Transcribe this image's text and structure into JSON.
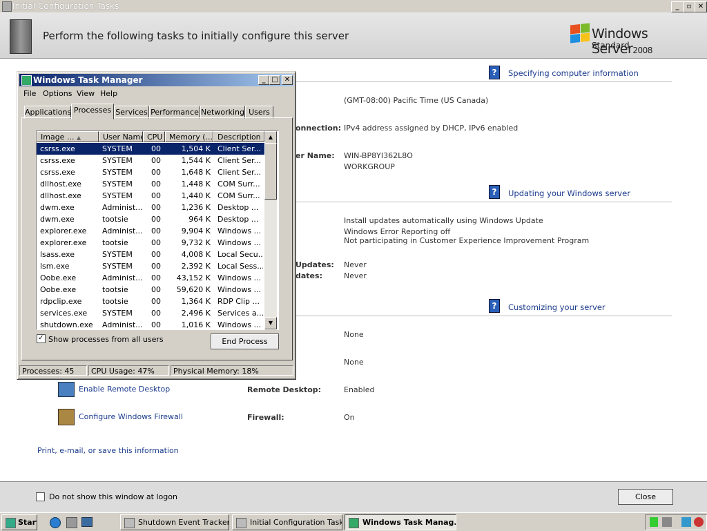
{
  "window": {
    "title": "Initial Configuration Tasks",
    "header_title": "Perform the following tasks to initially configure this server",
    "brand": {
      "name": "Windows Server",
      "version": "2008",
      "edition": "Standard"
    }
  },
  "sections": [
    {
      "title": "Specifying computer information",
      "id": "computer"
    },
    {
      "title": "Updating your Windows server",
      "id": "update"
    },
    {
      "title": "Customizing your server",
      "id": "customize"
    }
  ],
  "computer_info": {
    "time_zone_value": "(GMT-08:00) Pacific Time (US  Canada)",
    "network_label": "onnection:",
    "network_value": "IPv4 address assigned by DHCP, IPv6 enabled",
    "name_label": "er Name:",
    "name_value": "WIN-BP8YI362L8O",
    "workgroup_value": "WORKGROUP"
  },
  "update_info": {
    "line1": "Install updates automatically using Windows Update",
    "line2": "Windows Error Reporting off",
    "line3": "Not participating in Customer Experience Improvement Program",
    "updates_label": "Updates:",
    "updates_value": "Never",
    "dates_label": "dates:",
    "dates_value": "Never"
  },
  "customize_info": {
    "value1": "None",
    "value2": "None",
    "remote_link": "Enable Remote Desktop",
    "remote_label": "Remote Desktop:",
    "remote_value": "Enabled",
    "firewall_link": "Configure Windows Firewall",
    "firewall_label": "Firewall:",
    "firewall_value": "On"
  },
  "print_link": "Print, e-mail, or save this information",
  "footer": {
    "checkbox_label": "Do not show this window at logon",
    "close_label": "Close"
  },
  "task_manager": {
    "title": "Windows Task Manager",
    "menu": [
      "File",
      "Options",
      "View",
      "Help"
    ],
    "tabs": [
      "Applications",
      "Processes",
      "Services",
      "Performance",
      "Networking",
      "Users"
    ],
    "selected_tab": "Processes",
    "columns": [
      "Image ...",
      "User Name",
      "CPU",
      "Memory (...",
      "Description"
    ],
    "rows": [
      [
        "csrss.exe",
        "SYSTEM",
        "00",
        "1,504 K",
        "Client Ser..."
      ],
      [
        "csrss.exe",
        "SYSTEM",
        "00",
        "1,544 K",
        "Client Ser..."
      ],
      [
        "csrss.exe",
        "SYSTEM",
        "00",
        "1,648 K",
        "Client Ser..."
      ],
      [
        "dllhost.exe",
        "SYSTEM",
        "00",
        "1,448 K",
        "COM Surr..."
      ],
      [
        "dllhost.exe",
        "SYSTEM",
        "00",
        "1,440 K",
        "COM Surr..."
      ],
      [
        "dwm.exe",
        "Administ...",
        "00",
        "1,236 K",
        "Desktop ..."
      ],
      [
        "dwm.exe",
        "tootsie",
        "00",
        "964 K",
        "Desktop ..."
      ],
      [
        "explorer.exe",
        "Administ...",
        "00",
        "9,904 K",
        "Windows ..."
      ],
      [
        "explorer.exe",
        "tootsie",
        "00",
        "9,732 K",
        "Windows ..."
      ],
      [
        "lsass.exe",
        "SYSTEM",
        "00",
        "4,008 K",
        "Local Secu..."
      ],
      [
        "lsm.exe",
        "SYSTEM",
        "00",
        "2,392 K",
        "Local Sess..."
      ],
      [
        "Oobe.exe",
        "Administ...",
        "00",
        "43,152 K",
        "Windows ..."
      ],
      [
        "Oobe.exe",
        "tootsie",
        "00",
        "59,620 K",
        "Windows ..."
      ],
      [
        "rdpclip.exe",
        "tootsie",
        "00",
        "1,364 K",
        "RDP Clip ..."
      ],
      [
        "services.exe",
        "SYSTEM",
        "00",
        "2,496 K",
        "Services a..."
      ],
      [
        "shutdown.exe",
        "Administ...",
        "00",
        "1,016 K",
        "Windows ..."
      ]
    ],
    "show_all_label": "Show processes from all users",
    "show_all_checked": true,
    "end_process_label": "End Process",
    "status": {
      "processes": "Processes: 45",
      "cpu": "CPU Usage: 47%",
      "memory": "Physical Memory: 18%"
    }
  },
  "taskbar": {
    "start_label": "Start",
    "buttons": [
      "Shutdown Event Tracker",
      "Initial Configuration Tasks",
      "Windows Task Manag..."
    ],
    "active_button": "Windows Task Manag..."
  }
}
